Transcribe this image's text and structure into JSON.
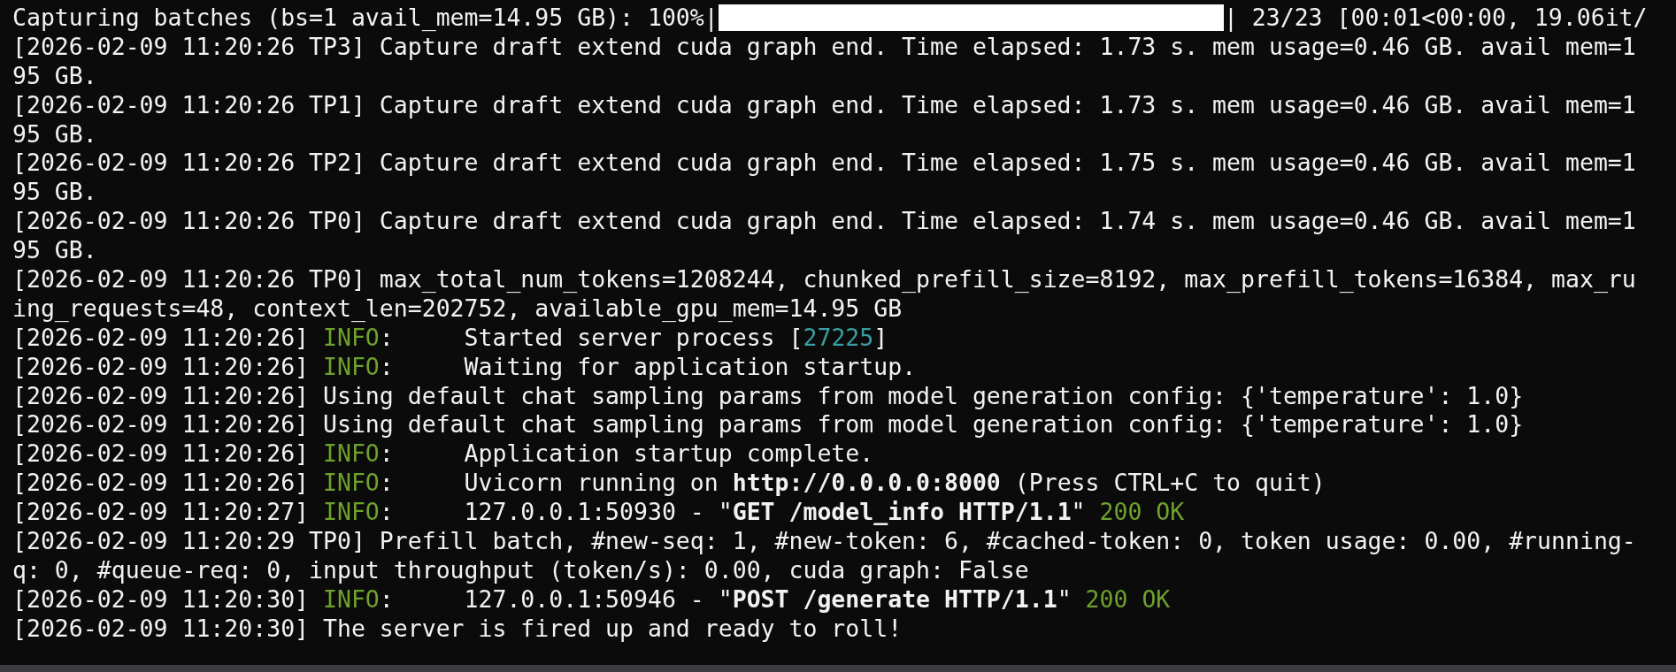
{
  "lines": [
    {
      "kind": "progress",
      "label": "Capturing batches (bs=1 avail_mem=14.95 GB): 100%|",
      "level": 1,
      "tail": "| 23/23 [00:01<00:00, 19.06it/"
    },
    {
      "kind": "text",
      "segments": [
        {
          "kind": "plain",
          "text": "[2026-02-09 11:20:26 TP3] Capture draft extend cuda graph end. Time elapsed: 1.73 s. mem usage=0.46 GB. avail mem=1"
        }
      ]
    },
    {
      "kind": "text",
      "segments": [
        {
          "kind": "plain",
          "text": "95 GB."
        }
      ]
    },
    {
      "kind": "text",
      "segments": [
        {
          "kind": "plain",
          "text": "[2026-02-09 11:20:26 TP1] Capture draft extend cuda graph end. Time elapsed: 1.73 s. mem usage=0.46 GB. avail mem=1"
        }
      ]
    },
    {
      "kind": "text",
      "segments": [
        {
          "kind": "plain",
          "text": "95 GB."
        }
      ]
    },
    {
      "kind": "text",
      "segments": [
        {
          "kind": "plain",
          "text": "[2026-02-09 11:20:26 TP2] Capture draft extend cuda graph end. Time elapsed: 1.75 s. mem usage=0.46 GB. avail mem=1"
        }
      ]
    },
    {
      "kind": "text",
      "segments": [
        {
          "kind": "plain",
          "text": "95 GB."
        }
      ]
    },
    {
      "kind": "text",
      "segments": [
        {
          "kind": "plain",
          "text": "[2026-02-09 11:20:26 TP0] Capture draft extend cuda graph end. Time elapsed: 1.74 s. mem usage=0.46 GB. avail mem=1"
        }
      ]
    },
    {
      "kind": "text",
      "segments": [
        {
          "kind": "plain",
          "text": "95 GB."
        }
      ]
    },
    {
      "kind": "text",
      "segments": [
        {
          "kind": "plain",
          "text": "[2026-02-09 11:20:26 TP0] max_total_num_tokens=1208244, chunked_prefill_size=8192, max_prefill_tokens=16384, max_ru"
        }
      ]
    },
    {
      "kind": "text",
      "segments": [
        {
          "kind": "plain",
          "text": "ing_requests=48, context_len=202752, available_gpu_mem=14.95 GB"
        }
      ]
    },
    {
      "kind": "text",
      "segments": [
        {
          "kind": "plain",
          "text": "[2026-02-09 11:20:26] "
        },
        {
          "kind": "level",
          "text": "INFO"
        },
        {
          "kind": "plain",
          "text": ":     Started server process ["
        },
        {
          "kind": "pid",
          "text": "27225"
        },
        {
          "kind": "plain",
          "text": "]"
        }
      ]
    },
    {
      "kind": "text",
      "segments": [
        {
          "kind": "plain",
          "text": "[2026-02-09 11:20:26] "
        },
        {
          "kind": "level",
          "text": "INFO"
        },
        {
          "kind": "plain",
          "text": ":     Waiting for application startup."
        }
      ]
    },
    {
      "kind": "text",
      "segments": [
        {
          "kind": "plain",
          "text": "[2026-02-09 11:20:26] Using default chat sampling params from model generation config: {'temperature': 1.0}"
        }
      ]
    },
    {
      "kind": "text",
      "segments": [
        {
          "kind": "plain",
          "text": "[2026-02-09 11:20:26] Using default chat sampling params from model generation config: {'temperature': 1.0}"
        }
      ]
    },
    {
      "kind": "text",
      "segments": [
        {
          "kind": "plain",
          "text": "[2026-02-09 11:20:26] "
        },
        {
          "kind": "level",
          "text": "INFO"
        },
        {
          "kind": "plain",
          "text": ":     Application startup complete."
        }
      ]
    },
    {
      "kind": "text",
      "segments": [
        {
          "kind": "plain",
          "text": "[2026-02-09 11:20:26] "
        },
        {
          "kind": "level",
          "text": "INFO"
        },
        {
          "kind": "plain",
          "text": ":     Uvicorn running on **http://0.0.0.0:8000** (Press CTRL+C to quit)"
        }
      ]
    },
    {
      "kind": "text",
      "segments": [
        {
          "kind": "plain",
          "text": "[2026-02-09 11:20:27] "
        },
        {
          "kind": "level",
          "text": "INFO"
        },
        {
          "kind": "plain",
          "text": ":     127.0.0.1:50930 - \"**GET /model_info HTTP/1.1**\" "
        },
        {
          "kind": "status",
          "text": "200 OK"
        }
      ]
    },
    {
      "kind": "text",
      "segments": [
        {
          "kind": "plain",
          "text": "[2026-02-09 11:20:29 TP0] Prefill batch, #new-seq: 1, #new-token: 6, #cached-token: 0, token usage: 0.00, #running-"
        }
      ]
    },
    {
      "kind": "text",
      "segments": [
        {
          "kind": "plain",
          "text": "q: 0, #queue-req: 0, input throughput (token/s): 0.00, cuda graph: False"
        }
      ]
    },
    {
      "kind": "text",
      "segments": [
        {
          "kind": "plain",
          "text": "[2026-02-09 11:20:30] "
        },
        {
          "kind": "level",
          "text": "INFO"
        },
        {
          "kind": "plain",
          "text": ":     127.0.0.1:50946 - \"**POST /generate HTTP/1.1**\" "
        },
        {
          "kind": "status",
          "text": "200 OK"
        }
      ]
    },
    {
      "kind": "text",
      "segments": [
        {
          "kind": "plain",
          "text": "[2026-02-09 11:20:30] The server is fired up and ready to roll!"
        }
      ]
    }
  ]
}
